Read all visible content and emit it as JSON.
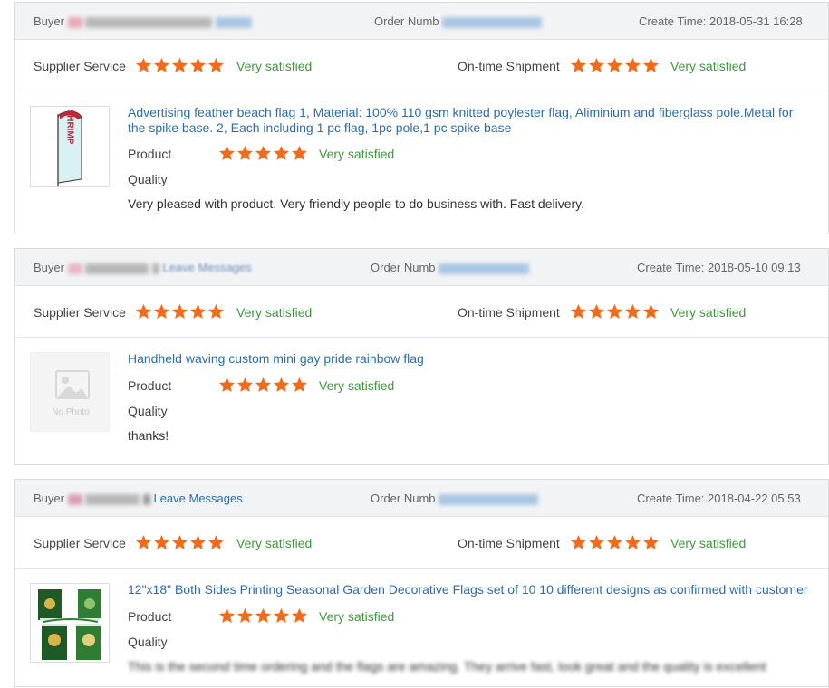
{
  "labels": {
    "buyer": "Buyer",
    "order_number": "Order Numb",
    "create_time": "Create Time:",
    "supplier_service": "Supplier Service",
    "ontime_shipment": "On-time Shipment",
    "product_quality_1": "Product",
    "product_quality_2": "Quality",
    "no_photo": "No Photo",
    "leave_messages": "Leave Messages"
  },
  "feedbacks": [
    {
      "create_time": "2018-05-31 16:28",
      "supplier_service_rating": "Very satisfied",
      "supplier_service_stars": 5,
      "ontime_rating": "Very satisfied",
      "ontime_stars": 5,
      "product_title": "Advertising feather beach flag 1, Material: 100% 110 gsm knitted poylester flag, Aliminium and fiberglass pole.Metal for the spike base. 2, Each including 1 pc flag, 1pc pole,1 pc spike base",
      "product_quality_rating": "Very satisfied",
      "product_quality_stars": 5,
      "comment": "Very pleased with product. Very friendly people to do business with. Fast delivery.",
      "thumb_text": "SHRIMP"
    },
    {
      "create_time": "2018-05-10 09:13",
      "supplier_service_rating": "Very satisfied",
      "supplier_service_stars": 5,
      "ontime_rating": "Very satisfied",
      "ontime_stars": 5,
      "product_title": "Handheld waving custom mini gay pride rainbow flag",
      "product_quality_rating": "Very satisfied",
      "product_quality_stars": 5,
      "comment": "thanks!"
    },
    {
      "create_time": "2018-04-22 05:53",
      "supplier_service_rating": "Very satisfied",
      "supplier_service_stars": 5,
      "ontime_rating": "Very satisfied",
      "ontime_stars": 5,
      "product_title": "12\"x18\" Both Sides Printing Seasonal Garden Decorative Flags set of 10 10 different designs as confirmed with customer",
      "product_quality_rating": "Very satisfied",
      "product_quality_stars": 5,
      "comment": "This is the second time ordering and the flags are amazing. They arrive fast, look great and the quality is excellent"
    }
  ],
  "colors": {
    "star": "#f26a1b",
    "satisfied": "#3a9a3a",
    "link": "#2b6cb0",
    "header_bg": "#f2f3f5"
  }
}
